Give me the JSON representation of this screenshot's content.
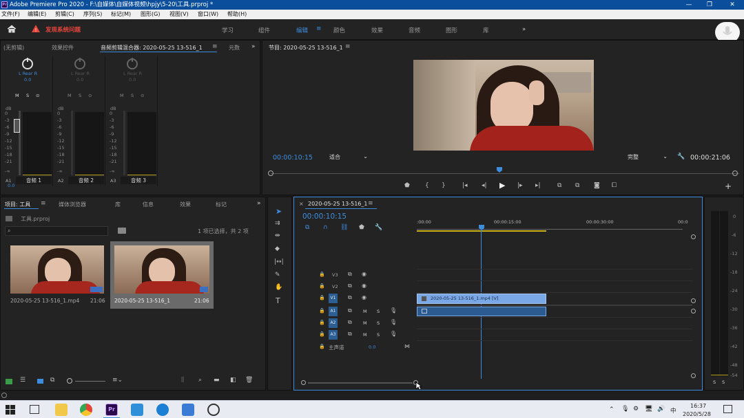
{
  "window": {
    "app_icon": "Pr",
    "title": "Adobe Premiere Pro 2020 - F:\\自媒体\\自媒体视频\\hpjy\\5-20\\工具.prproj *"
  },
  "menu": [
    "文件(F)",
    "编辑(E)",
    "剪辑(C)",
    "序列(S)",
    "标记(M)",
    "图形(G)",
    "视图(V)",
    "窗口(W)",
    "帮助(H)"
  ],
  "header": {
    "warning": "发现系统问题",
    "workspaces": [
      "学习",
      "组件",
      "编辑",
      "颜色",
      "效果",
      "音频",
      "图形",
      "库"
    ],
    "active_workspace": "编辑",
    "more": "»"
  },
  "mixer_panel": {
    "tabs": [
      "(无剪辑)",
      "效果控件",
      "音频剪辑混合器: 2020-05-25 13-516_1",
      "元数"
    ],
    "channels": [
      {
        "lr": "L  Rear  R",
        "value": "0.0",
        "track": "A1",
        "name": "音频 1",
        "active": true
      },
      {
        "lr": "L  Rear  R",
        "value": "0.0",
        "track": "A2",
        "name": "音频 2",
        "active": false
      },
      {
        "lr": "L  Rear  R",
        "value": "0.0",
        "track": "A3",
        "name": "音频 3",
        "active": false
      }
    ],
    "msb": [
      "M",
      "S",
      "⊙"
    ],
    "db_label": "dB",
    "db_scale": [
      "0",
      "-3",
      "-6",
      "-9",
      "-12",
      "-15",
      "-18",
      "-21",
      "-∞"
    ],
    "fader_value": "0.0"
  },
  "program": {
    "title": "节目: 2020-05-25 13-516_1",
    "timecode": "00:00:10:15",
    "fit": "适合",
    "quality": "完整",
    "duration": "00:00:21:06"
  },
  "project_panel": {
    "tabs": [
      "项目: 工具",
      "媒体浏览器",
      "库",
      "信息",
      "效果",
      "标记"
    ],
    "project_name": "工具.prproj",
    "selection": "1 项已选择，共 2 项",
    "items": [
      {
        "name": "2020-05-25 13-516_1.mp4",
        "duration": "21:06",
        "selected": false
      },
      {
        "name": "2020-05-25 13-516_1",
        "duration": "21:06",
        "selected": true
      }
    ]
  },
  "timeline": {
    "tab": "2020-05-25 13-516_1",
    "timecode": "00:00:10:15",
    "ruler": [
      ":00:00",
      "00:00:15:00",
      "00:00:30:00",
      "00:0"
    ],
    "video_tracks": [
      "V3",
      "V2",
      "V1"
    ],
    "audio_tracks": [
      "A1",
      "A2",
      "A3"
    ],
    "master": "主声道",
    "master_value": "0.0",
    "clip_video": "2020-05-25 13-516_1.mp4 [V]",
    "m": "M",
    "s": "S"
  },
  "meter": {
    "scale": [
      "0",
      "-6",
      "-12",
      "-18",
      "-24",
      "-30",
      "-36",
      "-42",
      "-48",
      "-54"
    ],
    "solo": [
      "S",
      "S"
    ]
  },
  "taskbar": {
    "time": "16:37",
    "date": "2020/5/28",
    "lang": "中"
  },
  "colors": {
    "accent": "#3c8dde",
    "clip": "#7aa7e6",
    "titlebar": "#0b4f9c"
  }
}
